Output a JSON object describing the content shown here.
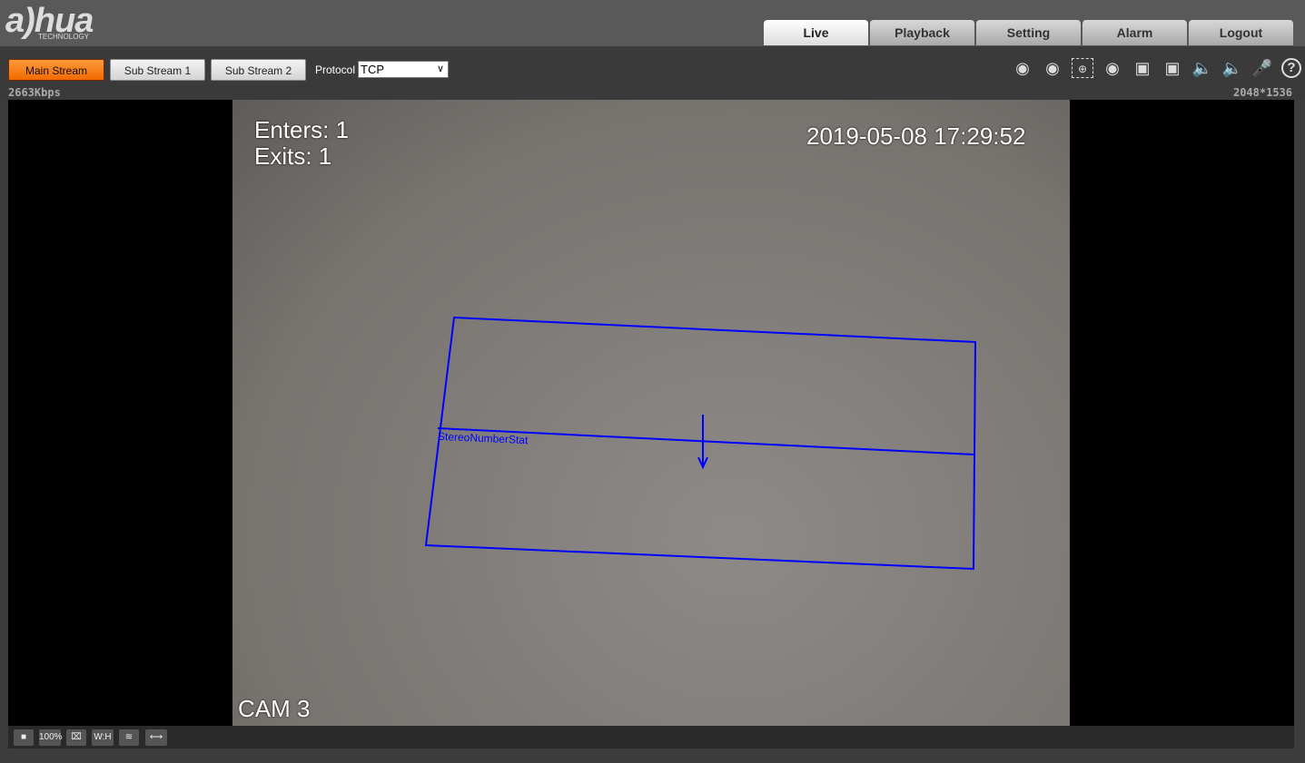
{
  "brand": {
    "name": "a)hua",
    "sub": "TECHNOLOGY"
  },
  "nav": {
    "tabs": [
      "Live",
      "Playback",
      "Setting",
      "Alarm",
      "Logout"
    ]
  },
  "toolbar": {
    "main_stream": "Main Stream",
    "sub_stream_1": "Sub Stream 1",
    "sub_stream_2": "Sub Stream 2",
    "protocol_label": "Protocol",
    "protocol_value": "TCP"
  },
  "status": {
    "bitrate": "2663Kbps",
    "resolution": "2048*1536"
  },
  "icons": [
    "alarm-out-1-icon",
    "alarm-out-2-icon",
    "zoom-region-icon",
    "snapshot-icon",
    "triple-snapshot-icon",
    "record-icon",
    "audio-1-icon",
    "audio-2-icon",
    "microphone-icon",
    "help-icon"
  ],
  "video": {
    "enters": "Enters: 1",
    "exits": "Exits: 1",
    "timestamp": "2019-05-08 17:29:52",
    "camera": "CAM 3",
    "rule_label": "StereoNumberStat",
    "rule_color": "#0000ff"
  },
  "bottom": {
    "zoom": "100%",
    "wh": "W:H"
  }
}
